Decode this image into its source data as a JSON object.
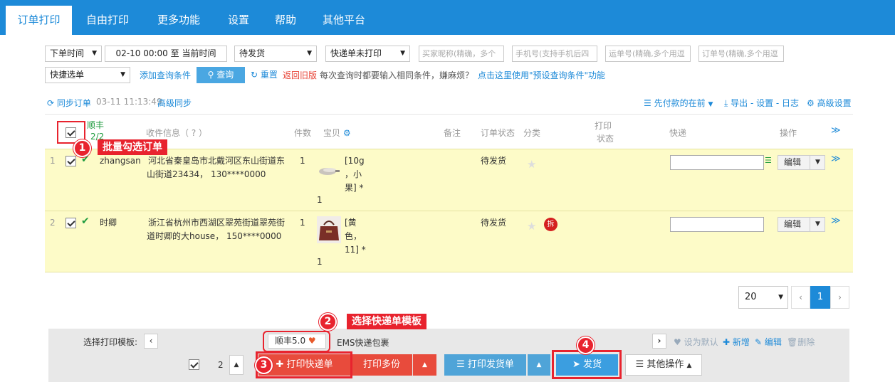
{
  "nav": {
    "tabs": [
      "订单打印",
      "自由打印",
      "更多功能",
      "设置",
      "帮助",
      "其他平台"
    ]
  },
  "filters": {
    "time_type": "下单时间",
    "time_range": "02-10 00:00 至 当前时间",
    "status": "待发货",
    "express_status": "快递单未打印",
    "buyer_placeholder": "买家昵称(精确，多个",
    "phone_placeholder": "手机号(支持手机后四",
    "waybill_placeholder": "运单号(精确,多个用逗",
    "order_placeholder": "订单号(精确,多个用逗",
    "quick_select": "快捷选单",
    "add_condition": "添加查询条件",
    "search": "查询",
    "reset": "重置",
    "old_version": "返回旧版",
    "tip_text": "每次查询时都要输入相同条件，嫌麻烦？",
    "tip_link": "点击这里使用\"预设查询条件\"功能"
  },
  "sync": {
    "label": "同步订单",
    "time": "03-11 11:13:49",
    "advanced": "高级同步",
    "sort": "先付款的在前",
    "export": "导出 - 设置 - 日志",
    "advanced_settings": "高级设置"
  },
  "table": {
    "select_all_carrier": "顺丰",
    "select_all_count": "2/2",
    "headers": {
      "receiver": "收件信息（ ? ）",
      "qty": "件数",
      "item": "宝贝",
      "remark": "备注",
      "order_status": "订单状态",
      "category": "分类",
      "print_status_1": "打印",
      "print_status_2": "状态",
      "express": "快递",
      "ops": "操作"
    },
    "rows": [
      {
        "idx": "1",
        "name": "zhangsan",
        "addr1": "河北省秦皇岛市北戴河区东山街道东",
        "addr2": "山街道23434， 130****0000",
        "qty": "1",
        "item1": "[10g",
        "item2": "，小",
        "item3": "果] *",
        "item_qty": "1",
        "status": "待发货",
        "edit": "编辑"
      },
      {
        "idx": "2",
        "name": "时卿",
        "addr1": "浙江省杭州市西湖区翠苑街道翠苑街",
        "addr2": "道时卿的大house， 150****0000",
        "qty": "1",
        "item1": "[黄",
        "item2": "色，",
        "item3": "11] *",
        "item_qty": "1",
        "status": "待发货",
        "split": "拆",
        "edit": "编辑"
      }
    ]
  },
  "pagination": {
    "page_size": "20",
    "current": "1",
    "prev": "‹",
    "next": "›"
  },
  "template_bar": {
    "label": "选择打印模板:",
    "template1": "顺丰5.0",
    "template2": "EMS快递包裹",
    "set_default": "设为默认",
    "add": "新增",
    "edit": "编辑",
    "delete": "删除"
  },
  "actions": {
    "count": "2",
    "print_express": "打印快递单",
    "print_multi": "打印多份",
    "print_delivery": "打印发货单",
    "ship": "发货",
    "other": "其他操作"
  },
  "annotations": {
    "a1": "1",
    "a1_label": "批量勾选订单",
    "a2": "2",
    "a2_label": "选择快递单模板",
    "a3": "3",
    "a4": "4"
  }
}
